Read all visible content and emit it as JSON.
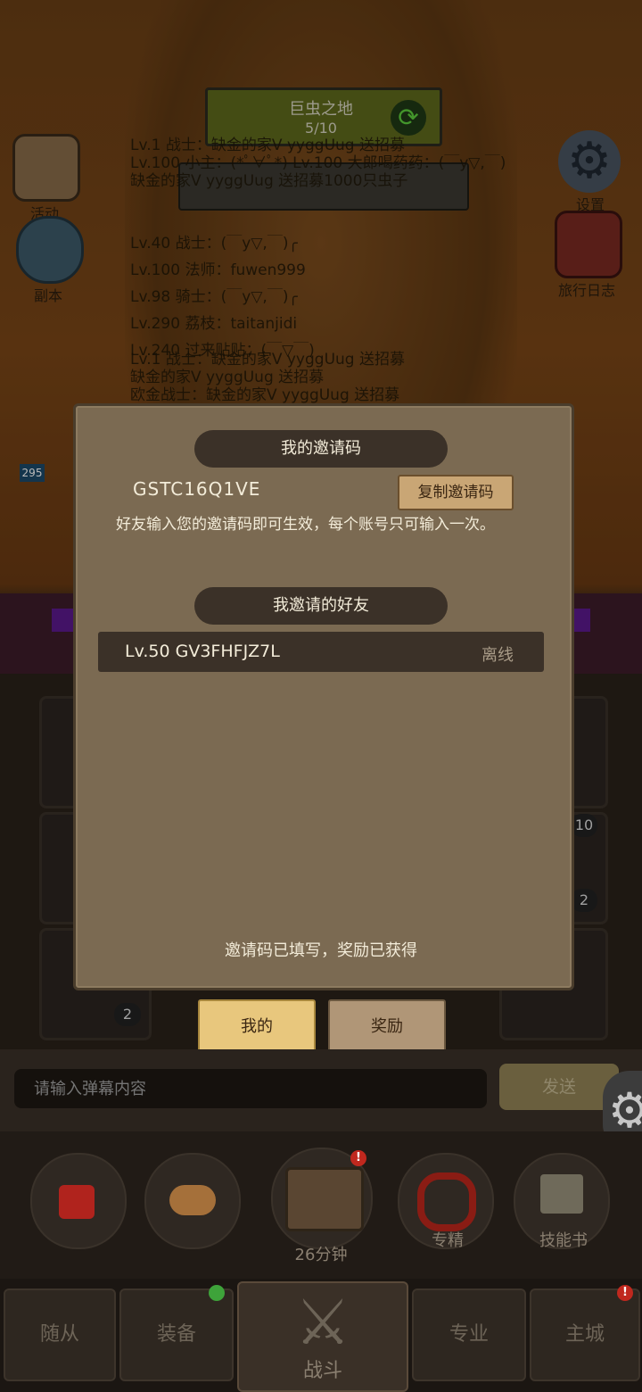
{
  "stage": {
    "name": "巨虫之地",
    "count": "5/10"
  },
  "chat_lines": [
    "Lv.1 战士：缺金的家V yyggUug 送招募",
    "Lv.100 小主：(*ﾟ∀ﾟ*) Lv.100 大郎喝药药：(￣y▽,￣)",
    "缺金的家V yyggUug 送招募1000只虫子",
    "Lv.40 战士：(￣y▽,￣)╭",
    "Lv.100 法师：fuwen999",
    "Lv.98 骑士：(￣y▽,￣)╭",
    "Lv.290 荔枝：taitanjidi",
    "Lv.240 过来贴贴：(￣▽￣)",
    "Lv.1 战士：缺金的家V yyggUug 送招募",
    "缺金的家V yyggUug 送招募",
    "欧金战士：缺金的家V yyggUug 送招募"
  ],
  "side_left": [
    {
      "label": "活动",
      "icon": "scroll-icon"
    },
    {
      "label": "副本",
      "icon": "portal-icon"
    }
  ],
  "side_right": [
    {
      "label": "设置",
      "icon": "gear-icon"
    },
    {
      "label": "旅行日志",
      "icon": "book-icon"
    }
  ],
  "enemy_level": "295",
  "modal": {
    "my_code_title": "我的邀请码",
    "my_code": "GSTC16Q1VE",
    "copy_button": "复制邀请码",
    "hint": "好友输入您的邀请码即可生效，每个账号只可输入一次。",
    "friends_title": "我邀请的好友",
    "friends": [
      {
        "name": "Lv.50 GV3FHFJZ7L",
        "status": "离线"
      }
    ],
    "footer": "邀请码已填写，奖励已获得"
  },
  "tabs": {
    "mine": "我的",
    "reward": "奖励"
  },
  "slot_badges": [
    "10",
    "2",
    "2"
  ],
  "danmaku": {
    "placeholder": "请输入弹幕内容",
    "send": "发送"
  },
  "quick": [
    {
      "icon": "potion-icon",
      "label": ""
    },
    {
      "icon": "bread-icon",
      "label": ""
    },
    {
      "icon": "chest-icon",
      "label": "26分钟",
      "badge": "!"
    },
    {
      "icon": "refine-icon",
      "label": "专精"
    },
    {
      "icon": "skillbook-icon",
      "label": "技能书"
    }
  ],
  "nav": {
    "followers": "随从",
    "equipment": "装备",
    "battle": "战斗",
    "specialty": "专业",
    "main_city": "主城"
  },
  "colors": {
    "modal_bg": "#7b6a52",
    "banner_bg": "#3b3128",
    "tab_active": "#e8c77d",
    "alert": "#c0281e",
    "ok": "#3ea33a"
  }
}
